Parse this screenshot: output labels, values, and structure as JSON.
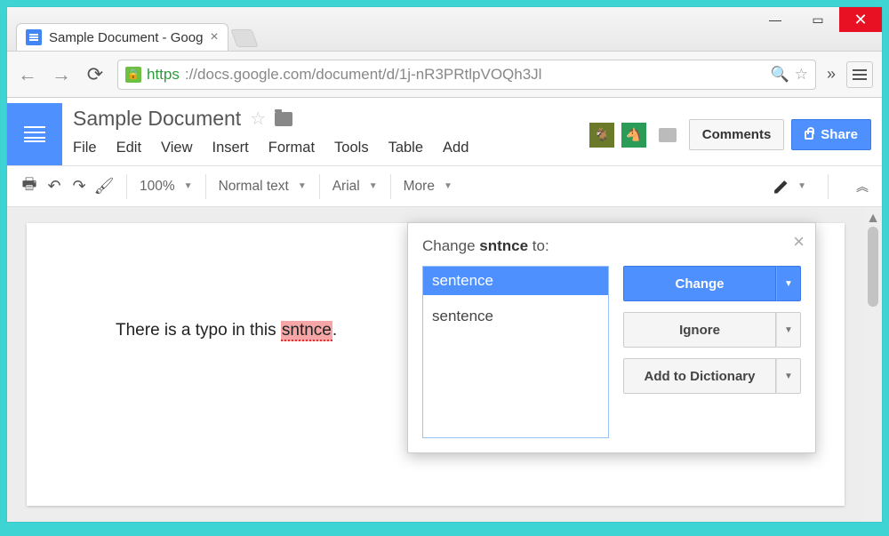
{
  "window": {
    "minimize": "—",
    "maximize": "▭",
    "close": "✕"
  },
  "browser": {
    "tab_title": "Sample Document - Goog",
    "tab_close": "×",
    "url_https": "https",
    "url_rest": "://docs.google.com/document/d/1j-nR3PRtlpVOQh3Jl",
    "search_glyph": "🔍",
    "star_glyph": "☆",
    "overflow": "»"
  },
  "docs": {
    "title": "Sample Document",
    "star": "☆",
    "menu": {
      "file": "File",
      "edit": "Edit",
      "view": "View",
      "insert": "Insert",
      "format": "Format",
      "tools": "Tools",
      "table": "Table",
      "addons": "Add"
    },
    "comments_btn": "Comments",
    "share_btn": "Share"
  },
  "toolbar": {
    "zoom": "100%",
    "style": "Normal text",
    "font": "Arial",
    "more": "More",
    "collapse": "︽"
  },
  "document": {
    "text_before": "There is a typo in this ",
    "misspelled": "sntnce",
    "text_after": "."
  },
  "spell": {
    "title_prefix": "Change ",
    "title_word": "sntnce",
    "title_suffix": " to:",
    "selected": "sentence",
    "option1": "sentence",
    "change": "Change",
    "ignore": "Ignore",
    "add": "Add to Dictionary",
    "close": "×",
    "caret": "▼"
  }
}
